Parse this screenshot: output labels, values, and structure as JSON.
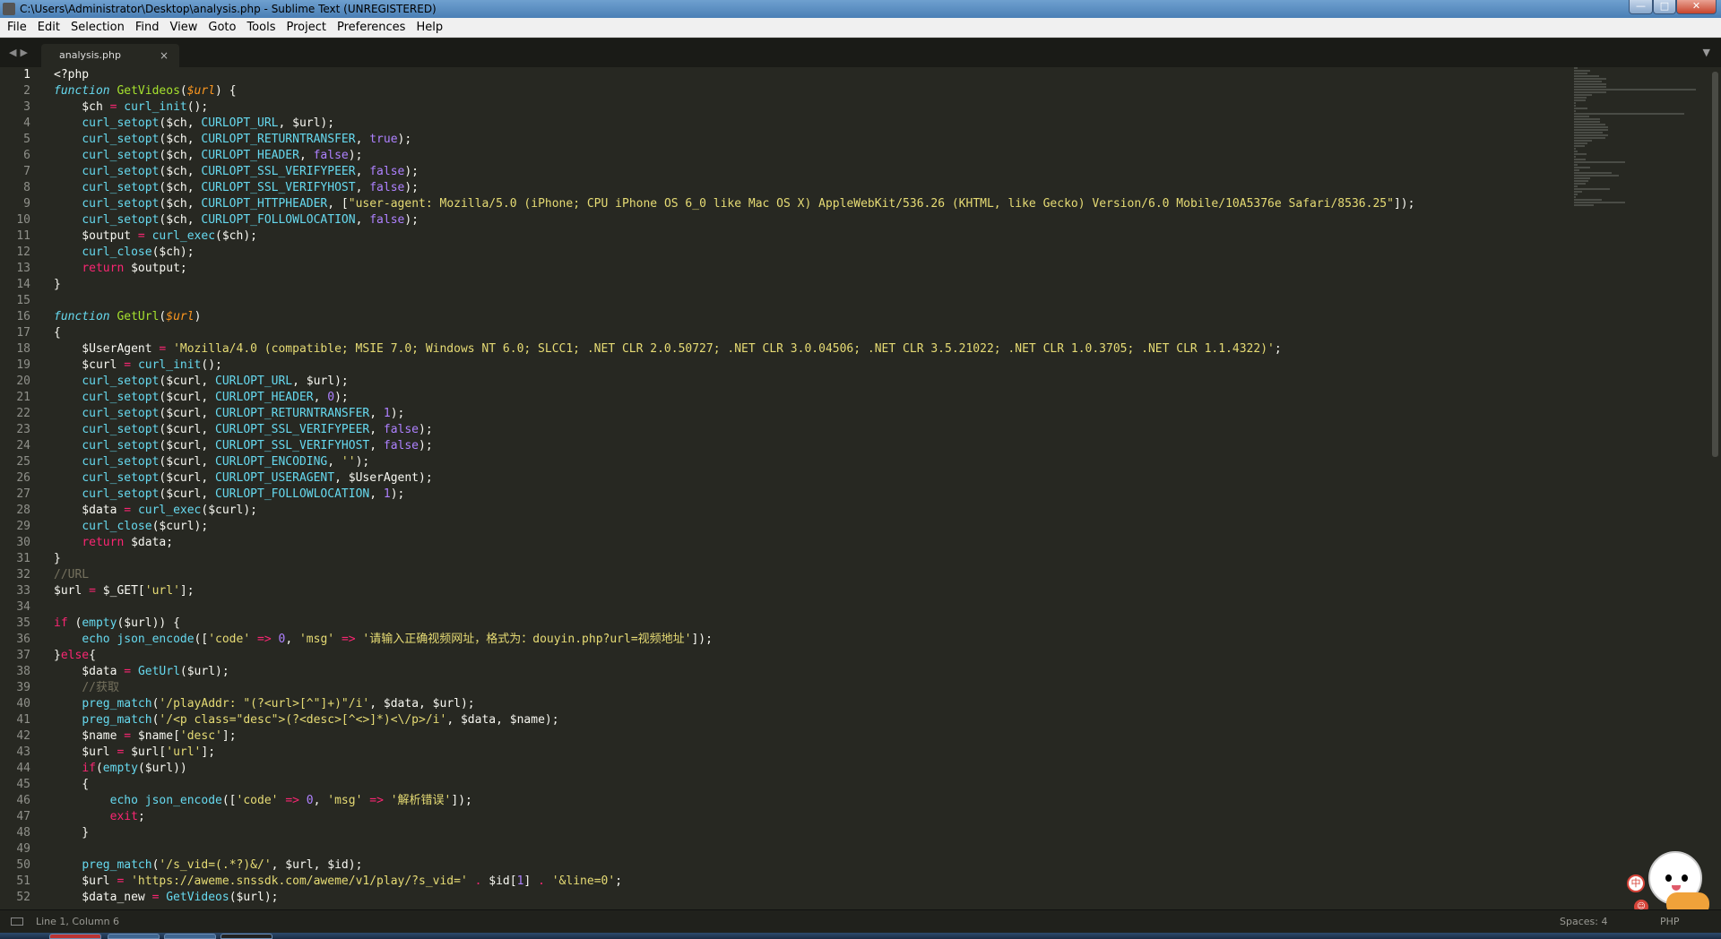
{
  "window": {
    "title": "C:\\Users\\Administrator\\Desktop\\analysis.php - Sublime Text (UNREGISTERED)",
    "controls": [
      "—",
      "□",
      "✕"
    ]
  },
  "menu": {
    "items": [
      "File",
      "Edit",
      "Selection",
      "Find",
      "View",
      "Goto",
      "Tools",
      "Project",
      "Preferences",
      "Help"
    ]
  },
  "tabs": {
    "nav_left": "◀",
    "nav_right": "▶",
    "active": {
      "label": "analysis.php",
      "close": "×"
    },
    "menu_icon": "▼"
  },
  "editor": {
    "lines": [
      [
        [
          "plain",
          "<?php"
        ]
      ],
      [
        [
          "fnkw",
          "function"
        ],
        [
          "plain",
          " "
        ],
        [
          "fn",
          "GetVideos"
        ],
        [
          "plain",
          "("
        ],
        [
          "param",
          "$url"
        ],
        [
          "plain",
          ") {"
        ]
      ],
      [
        [
          "plain",
          "    $ch "
        ],
        [
          "op",
          "="
        ],
        [
          "plain",
          " "
        ],
        [
          "call",
          "curl_init"
        ],
        [
          "plain",
          "();"
        ]
      ],
      [
        [
          "plain",
          "    "
        ],
        [
          "call",
          "curl_setopt"
        ],
        [
          "plain",
          "($ch, "
        ],
        [
          "const",
          "CURLOPT_URL"
        ],
        [
          "plain",
          ", $url);"
        ]
      ],
      [
        [
          "plain",
          "    "
        ],
        [
          "call",
          "curl_setopt"
        ],
        [
          "plain",
          "($ch, "
        ],
        [
          "const",
          "CURLOPT_RETURNTRANSFER"
        ],
        [
          "plain",
          ", "
        ],
        [
          "bool",
          "true"
        ],
        [
          "plain",
          ");"
        ]
      ],
      [
        [
          "plain",
          "    "
        ],
        [
          "call",
          "curl_setopt"
        ],
        [
          "plain",
          "($ch, "
        ],
        [
          "const",
          "CURLOPT_HEADER"
        ],
        [
          "plain",
          ", "
        ],
        [
          "bool",
          "false"
        ],
        [
          "plain",
          ");"
        ]
      ],
      [
        [
          "plain",
          "    "
        ],
        [
          "call",
          "curl_setopt"
        ],
        [
          "plain",
          "($ch, "
        ],
        [
          "const",
          "CURLOPT_SSL_VERIFYPEER"
        ],
        [
          "plain",
          ", "
        ],
        [
          "bool",
          "false"
        ],
        [
          "plain",
          ");"
        ]
      ],
      [
        [
          "plain",
          "    "
        ],
        [
          "call",
          "curl_setopt"
        ],
        [
          "plain",
          "($ch, "
        ],
        [
          "const",
          "CURLOPT_SSL_VERIFYHOST"
        ],
        [
          "plain",
          ", "
        ],
        [
          "bool",
          "false"
        ],
        [
          "plain",
          ");"
        ]
      ],
      [
        [
          "plain",
          "    "
        ],
        [
          "call",
          "curl_setopt"
        ],
        [
          "plain",
          "($ch, "
        ],
        [
          "const",
          "CURLOPT_HTTPHEADER"
        ],
        [
          "plain",
          ", ["
        ],
        [
          "str",
          "\"user-agent: Mozilla/5.0 (iPhone; CPU iPhone OS 6_0 like Mac OS X) AppleWebKit/536.26 (KHTML, like Gecko) Version/6.0 Mobile/10A5376e Safari/8536.25\""
        ],
        [
          "plain",
          "]);"
        ]
      ],
      [
        [
          "plain",
          "    "
        ],
        [
          "call",
          "curl_setopt"
        ],
        [
          "plain",
          "($ch, "
        ],
        [
          "const",
          "CURLOPT_FOLLOWLOCATION"
        ],
        [
          "plain",
          ", "
        ],
        [
          "bool",
          "false"
        ],
        [
          "plain",
          ");"
        ]
      ],
      [
        [
          "plain",
          "    $output "
        ],
        [
          "op",
          "="
        ],
        [
          "plain",
          " "
        ],
        [
          "call",
          "curl_exec"
        ],
        [
          "plain",
          "($ch);"
        ]
      ],
      [
        [
          "plain",
          "    "
        ],
        [
          "call",
          "curl_close"
        ],
        [
          "plain",
          "($ch);"
        ]
      ],
      [
        [
          "plain",
          "    "
        ],
        [
          "kw",
          "return"
        ],
        [
          "plain",
          " $output;"
        ]
      ],
      [
        [
          "plain",
          "}"
        ]
      ],
      [
        [
          "plain",
          ""
        ]
      ],
      [
        [
          "fnkw",
          "function"
        ],
        [
          "plain",
          " "
        ],
        [
          "fn",
          "GetUrl"
        ],
        [
          "plain",
          "("
        ],
        [
          "param",
          "$url"
        ],
        [
          "plain",
          ")"
        ]
      ],
      [
        [
          "plain",
          "{"
        ]
      ],
      [
        [
          "plain",
          "    $UserAgent "
        ],
        [
          "op",
          "="
        ],
        [
          "plain",
          " "
        ],
        [
          "str",
          "'Mozilla/4.0 (compatible; MSIE 7.0; Windows NT 6.0; SLCC1; .NET CLR 2.0.50727; .NET CLR 3.0.04506; .NET CLR 3.5.21022; .NET CLR 1.0.3705; .NET CLR 1.1.4322)'"
        ],
        [
          "plain",
          ";"
        ]
      ],
      [
        [
          "plain",
          "    $curl "
        ],
        [
          "op",
          "="
        ],
        [
          "plain",
          " "
        ],
        [
          "call",
          "curl_init"
        ],
        [
          "plain",
          "();"
        ]
      ],
      [
        [
          "plain",
          "    "
        ],
        [
          "call",
          "curl_setopt"
        ],
        [
          "plain",
          "($curl, "
        ],
        [
          "const",
          "CURLOPT_URL"
        ],
        [
          "plain",
          ", $url);"
        ]
      ],
      [
        [
          "plain",
          "    "
        ],
        [
          "call",
          "curl_setopt"
        ],
        [
          "plain",
          "($curl, "
        ],
        [
          "const",
          "CURLOPT_HEADER"
        ],
        [
          "plain",
          ", "
        ],
        [
          "num",
          "0"
        ],
        [
          "plain",
          ");"
        ]
      ],
      [
        [
          "plain",
          "    "
        ],
        [
          "call",
          "curl_setopt"
        ],
        [
          "plain",
          "($curl, "
        ],
        [
          "const",
          "CURLOPT_RETURNTRANSFER"
        ],
        [
          "plain",
          ", "
        ],
        [
          "num",
          "1"
        ],
        [
          "plain",
          ");"
        ]
      ],
      [
        [
          "plain",
          "    "
        ],
        [
          "call",
          "curl_setopt"
        ],
        [
          "plain",
          "($curl, "
        ],
        [
          "const",
          "CURLOPT_SSL_VERIFYPEER"
        ],
        [
          "plain",
          ", "
        ],
        [
          "bool",
          "false"
        ],
        [
          "plain",
          ");"
        ]
      ],
      [
        [
          "plain",
          "    "
        ],
        [
          "call",
          "curl_setopt"
        ],
        [
          "plain",
          "($curl, "
        ],
        [
          "const",
          "CURLOPT_SSL_VERIFYHOST"
        ],
        [
          "plain",
          ", "
        ],
        [
          "bool",
          "false"
        ],
        [
          "plain",
          ");"
        ]
      ],
      [
        [
          "plain",
          "    "
        ],
        [
          "call",
          "curl_setopt"
        ],
        [
          "plain",
          "($curl, "
        ],
        [
          "const",
          "CURLOPT_ENCODING"
        ],
        [
          "plain",
          ", "
        ],
        [
          "str",
          "''"
        ],
        [
          "plain",
          ");"
        ]
      ],
      [
        [
          "plain",
          "    "
        ],
        [
          "call",
          "curl_setopt"
        ],
        [
          "plain",
          "($curl, "
        ],
        [
          "const",
          "CURLOPT_USERAGENT"
        ],
        [
          "plain",
          ", $UserAgent);"
        ]
      ],
      [
        [
          "plain",
          "    "
        ],
        [
          "call",
          "curl_setopt"
        ],
        [
          "plain",
          "($curl, "
        ],
        [
          "const",
          "CURLOPT_FOLLOWLOCATION"
        ],
        [
          "plain",
          ", "
        ],
        [
          "num",
          "1"
        ],
        [
          "plain",
          ");"
        ]
      ],
      [
        [
          "plain",
          "    $data "
        ],
        [
          "op",
          "="
        ],
        [
          "plain",
          " "
        ],
        [
          "call",
          "curl_exec"
        ],
        [
          "plain",
          "($curl);"
        ]
      ],
      [
        [
          "plain",
          "    "
        ],
        [
          "call",
          "curl_close"
        ],
        [
          "plain",
          "($curl);"
        ]
      ],
      [
        [
          "plain",
          "    "
        ],
        [
          "kw",
          "return"
        ],
        [
          "plain",
          " $data;"
        ]
      ],
      [
        [
          "plain",
          "}"
        ]
      ],
      [
        [
          "cmt",
          "//URL"
        ]
      ],
      [
        [
          "plain",
          "$url "
        ],
        [
          "op",
          "="
        ],
        [
          "plain",
          " $_GET["
        ],
        [
          "str",
          "'url'"
        ],
        [
          "plain",
          "];"
        ]
      ],
      [
        [
          "plain",
          ""
        ]
      ],
      [
        [
          "kw",
          "if"
        ],
        [
          "plain",
          " ("
        ],
        [
          "call",
          "empty"
        ],
        [
          "plain",
          "($url)) {"
        ]
      ],
      [
        [
          "plain",
          "    "
        ],
        [
          "call",
          "echo"
        ],
        [
          "plain",
          " "
        ],
        [
          "call",
          "json_encode"
        ],
        [
          "plain",
          "(["
        ],
        [
          "str",
          "'code'"
        ],
        [
          "plain",
          " "
        ],
        [
          "op",
          "=>"
        ],
        [
          "plain",
          " "
        ],
        [
          "num",
          "0"
        ],
        [
          "plain",
          ", "
        ],
        [
          "str",
          "'msg'"
        ],
        [
          "plain",
          " "
        ],
        [
          "op",
          "=>"
        ],
        [
          "plain",
          " "
        ],
        [
          "str",
          "'请输入正确视频网址，格式为：douyin.php?url=视频地址'"
        ],
        [
          "plain",
          "]);"
        ]
      ],
      [
        [
          "plain",
          "}"
        ],
        [
          "kw",
          "else"
        ],
        [
          "plain",
          "{"
        ]
      ],
      [
        [
          "plain",
          "    $data "
        ],
        [
          "op",
          "="
        ],
        [
          "plain",
          " "
        ],
        [
          "call",
          "GetUrl"
        ],
        [
          "plain",
          "($url);"
        ]
      ],
      [
        [
          "plain",
          "    "
        ],
        [
          "cmt",
          "//获取"
        ]
      ],
      [
        [
          "plain",
          "    "
        ],
        [
          "call",
          "preg_match"
        ],
        [
          "plain",
          "("
        ],
        [
          "str",
          "'/playAddr: \"(?<url>[^\"]+)\"/i'"
        ],
        [
          "plain",
          ", $data, $url);"
        ]
      ],
      [
        [
          "plain",
          "    "
        ],
        [
          "call",
          "preg_match"
        ],
        [
          "plain",
          "("
        ],
        [
          "str",
          "'/<p class=\"desc\">(?<desc>[^<>]*)<\\/p>/i'"
        ],
        [
          "plain",
          ", $data, $name);"
        ]
      ],
      [
        [
          "plain",
          "    $name "
        ],
        [
          "op",
          "="
        ],
        [
          "plain",
          " $name["
        ],
        [
          "str",
          "'desc'"
        ],
        [
          "plain",
          "];"
        ]
      ],
      [
        [
          "plain",
          "    $url "
        ],
        [
          "op",
          "="
        ],
        [
          "plain",
          " $url["
        ],
        [
          "str",
          "'url'"
        ],
        [
          "plain",
          "];"
        ]
      ],
      [
        [
          "plain",
          "    "
        ],
        [
          "kw",
          "if"
        ],
        [
          "plain",
          "("
        ],
        [
          "call",
          "empty"
        ],
        [
          "plain",
          "($url))"
        ]
      ],
      [
        [
          "plain",
          "    {"
        ]
      ],
      [
        [
          "plain",
          "        "
        ],
        [
          "call",
          "echo"
        ],
        [
          "plain",
          " "
        ],
        [
          "call",
          "json_encode"
        ],
        [
          "plain",
          "(["
        ],
        [
          "str",
          "'code'"
        ],
        [
          "plain",
          " "
        ],
        [
          "op",
          "=>"
        ],
        [
          "plain",
          " "
        ],
        [
          "num",
          "0"
        ],
        [
          "plain",
          ", "
        ],
        [
          "str",
          "'msg'"
        ],
        [
          "plain",
          " "
        ],
        [
          "op",
          "=>"
        ],
        [
          "plain",
          " "
        ],
        [
          "str",
          "'解析错误'"
        ],
        [
          "plain",
          "]);"
        ]
      ],
      [
        [
          "plain",
          "        "
        ],
        [
          "kw",
          "exit"
        ],
        [
          "plain",
          ";"
        ]
      ],
      [
        [
          "plain",
          "    }"
        ]
      ],
      [
        [
          "plain",
          ""
        ]
      ],
      [
        [
          "plain",
          "    "
        ],
        [
          "call",
          "preg_match"
        ],
        [
          "plain",
          "("
        ],
        [
          "str",
          "'/s_vid=(.*?)&/'"
        ],
        [
          "plain",
          ", $url, $id);"
        ]
      ],
      [
        [
          "plain",
          "    $url "
        ],
        [
          "op",
          "="
        ],
        [
          "plain",
          " "
        ],
        [
          "str",
          "'https://aweme.snssdk.com/aweme/v1/play/?s_vid='"
        ],
        [
          "plain",
          " "
        ],
        [
          "op",
          "."
        ],
        [
          "plain",
          " $id["
        ],
        [
          "num",
          "1"
        ],
        [
          "plain",
          "] "
        ],
        [
          "op",
          "."
        ],
        [
          "plain",
          " "
        ],
        [
          "str",
          "'&line=0'"
        ],
        [
          "plain",
          ";"
        ]
      ],
      [
        [
          "plain",
          "    $data_new "
        ],
        [
          "op",
          "="
        ],
        [
          "plain",
          " "
        ],
        [
          "call",
          "GetVideos"
        ],
        [
          "plain",
          "($url);"
        ]
      ]
    ]
  },
  "status": {
    "position": "Line 1, Column 6",
    "indentation": "Spaces: 4",
    "syntax": "PHP"
  },
  "ime": {
    "label": "中"
  },
  "colors": {
    "editor_bg": "#272822",
    "keyword": "#f92672",
    "string": "#e6db74",
    "function": "#a6e22e",
    "builtin": "#66d9ef",
    "number": "#ae81ff",
    "comment": "#75715e"
  }
}
